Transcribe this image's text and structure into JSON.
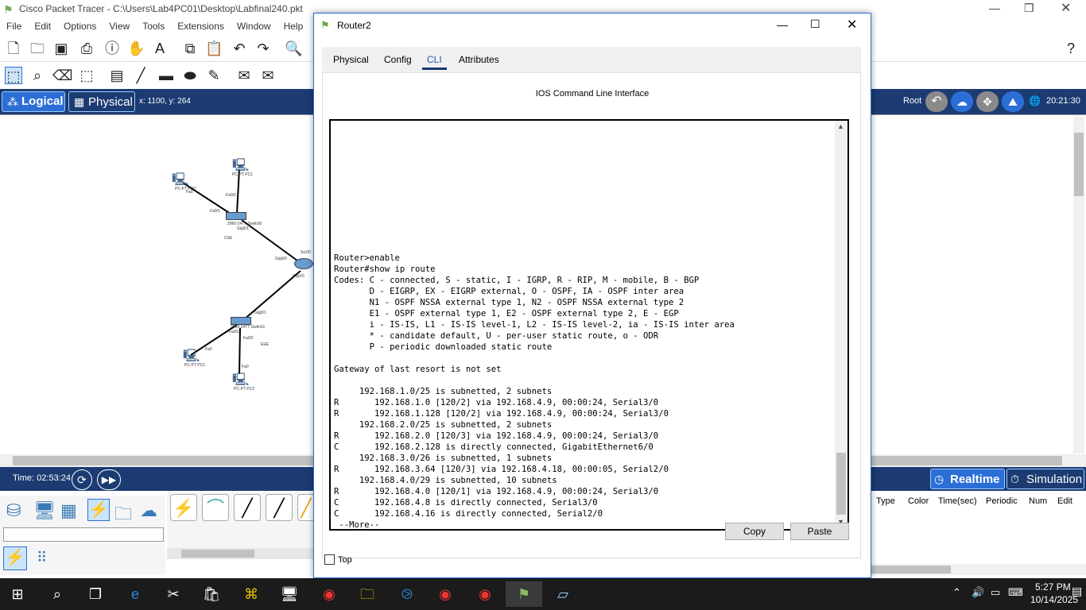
{
  "app": {
    "title": "Cisco Packet Tracer - C:\\Users\\Lab4PC01\\Desktop\\Labfinal240.pkt",
    "menu": [
      "File",
      "Edit",
      "Options",
      "View",
      "Tools",
      "Extensions",
      "Window",
      "Help"
    ]
  },
  "workspace_bar": {
    "logical_label": "Logical",
    "physical_label": "Physical",
    "coords": "x: 1100, y: 264",
    "root_label": "Root",
    "clock": "20:21:30"
  },
  "topology": {
    "labels": {
      "pc0": "PC-PT\nPC0",
      "pc0_port": "Fa0",
      "pc1top": "PC-PT\nPC1",
      "sw0": "2960-24TT\nSwitch0",
      "sw0_g": "Gig0/1",
      "sw0_fa1": "Fa0/1",
      "sw0_fa2": "Fa0/2",
      "r_g": "Gig0/0",
      "r_se": "Se2/0",
      "r_g1": "Gig1/0",
      "sw1": "2960-24TT\nSwitch1",
      "sw1_g": "Gig0/1",
      "sw1_fa1": "Fa0/1",
      "sw1_fa2": "Fa0/2",
      "pc_bl": "PC-PT\nPC1",
      "pc_bl_port": "Fa0",
      "pc_bc": "PC-PT\nPC2",
      "pc_bc_port": "Fa0",
      "cse": "CSE",
      "eee": "EEE"
    }
  },
  "timebar": {
    "time": "Time: 02:53:24",
    "realtime": "Realtime",
    "simulation": "Simulation"
  },
  "event_table": {
    "columns": [
      "Type",
      "Color",
      "Time(sec)",
      "Periodic",
      "Num",
      "Edit"
    ]
  },
  "dialog": {
    "title": "Router2",
    "tabs": [
      "Physical",
      "Config",
      "CLI",
      "Attributes"
    ],
    "active_tab": "CLI",
    "heading": "IOS Command Line Interface",
    "cli_text": "Router>enable\nRouter#show ip route\nCodes: C - connected, S - static, I - IGRP, R - RIP, M - mobile, B - BGP\n       D - EIGRP, EX - EIGRP external, O - OSPF, IA - OSPF inter area\n       N1 - OSPF NSSA external type 1, N2 - OSPF NSSA external type 2\n       E1 - OSPF external type 1, E2 - OSPF external type 2, E - EGP\n       i - IS-IS, L1 - IS-IS level-1, L2 - IS-IS level-2, ia - IS-IS inter area\n       * - candidate default, U - per-user static route, o - ODR\n       P - periodic downloaded static route\n\nGateway of last resort is not set\n\n     192.168.1.0/25 is subnetted, 2 subnets\nR       192.168.1.0 [120/2] via 192.168.4.9, 00:00:24, Serial3/0\nR       192.168.1.128 [120/2] via 192.168.4.9, 00:00:24, Serial3/0\n     192.168.2.0/25 is subnetted, 2 subnets\nR       192.168.2.0 [120/3] via 192.168.4.9, 00:00:24, Serial3/0\nC       192.168.2.128 is directly connected, GigabitEthernet6/0\n     192.168.3.0/26 is subnetted, 1 subnets\nR       192.168.3.64 [120/3] via 192.168.4.18, 00:00:05, Serial2/0\n     192.168.4.0/29 is subnetted, 10 subnets\nR       192.168.4.0 [120/1] via 192.168.4.9, 00:00:24, Serial3/0\nC       192.168.4.8 is directly connected, Serial3/0\nC       192.168.4.16 is directly connected, Serial2/0\n --More--",
    "copy_label": "Copy",
    "paste_label": "Paste",
    "top_label": "Top"
  },
  "taskbar": {
    "time": "5:27 PM",
    "date": "10/14/2025"
  },
  "colors": {
    "accent": "#1c3b72",
    "dialog_border": "#2b6fd6",
    "taskbar": "#1b1b1b"
  }
}
